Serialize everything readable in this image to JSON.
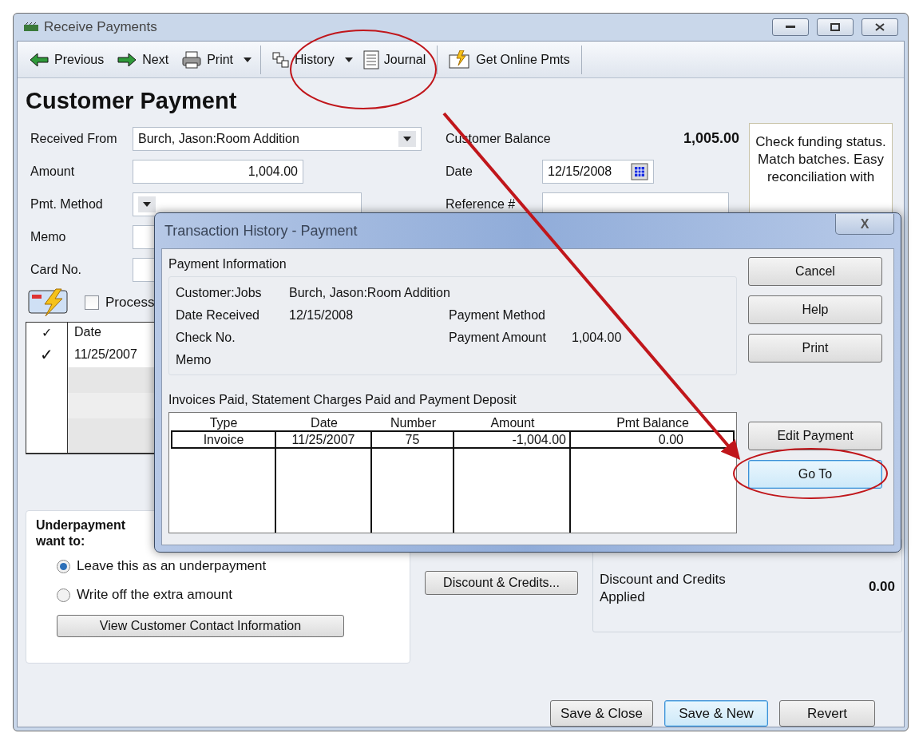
{
  "window": {
    "title": "Receive Payments"
  },
  "toolbar": [
    {
      "label": "Previous"
    },
    {
      "label": "Next"
    },
    {
      "label": "Print",
      "dropdown": true
    },
    {
      "label": "History",
      "dropdown": true
    },
    {
      "label": "Journal"
    },
    {
      "label": "Get Online Pmts"
    }
  ],
  "form": {
    "heading": "Customer Payment",
    "fields": [
      {
        "label": "Received From",
        "value": "Burch, Jason:Room Addition",
        "kind": "combo"
      },
      {
        "label": "Amount",
        "value": "1,004.00",
        "kind": "number"
      },
      {
        "label": "Pmt. Method",
        "kind": "combo"
      },
      {
        "label": "Memo",
        "kind": "text"
      },
      {
        "label": "Card No.",
        "kind": "text"
      }
    ],
    "process": {
      "label": "Process",
      "checked": false
    },
    "customer_balance": {
      "label": "Customer Balance",
      "value": "1,005.00"
    },
    "date": {
      "label": "Date",
      "value": "12/15/2008"
    },
    "reference": {
      "label": "Reference #"
    },
    "promo": "Check funding status. Match batches. Easy reconciliation with",
    "invoices": {
      "columns": [
        "✓",
        "Date"
      ],
      "rows": [
        {
          "checked": true,
          "date": "11/25/2007"
        }
      ]
    }
  },
  "underpayment": {
    "title": [
      "Underpayment",
      "want to:"
    ],
    "options": [
      {
        "label": "Leave this as an underpayment",
        "selected": true
      },
      {
        "label": "Write off the extra amount",
        "selected": false
      }
    ],
    "button": "View Customer Contact Information"
  },
  "discount_button": "Discount & Credits...",
  "summary": {
    "label": "Discount and Credits Applied",
    "value": "0.00"
  },
  "actions": [
    {
      "label": "Save & Close",
      "default": false
    },
    {
      "label": "Save & New",
      "default": true
    },
    {
      "label": "Revert",
      "default": false
    }
  ],
  "dialog": {
    "title": "Transaction History - Payment",
    "close": "X",
    "info_title": "Payment Information",
    "info": [
      {
        "label": "Customer:Jobs",
        "value": "Burch, Jason:Room Addition"
      },
      {
        "label": "Date Received",
        "value": "12/15/2008",
        "right_label": "Payment Method"
      },
      {
        "label": "Check No.",
        "right_label": "Payment Amount",
        "right_value": "1,004.00"
      },
      {
        "label": "Memo"
      }
    ],
    "table_title": "Invoices Paid, Statement Charges Paid and Payment Deposit",
    "columns": [
      "Type",
      "Date",
      "Number",
      "Amount",
      "Pmt Balance"
    ],
    "rows": [
      [
        "Invoice",
        "11/25/2007",
        "75",
        "-1,004.00",
        "0.00"
      ]
    ],
    "buttons_top": [
      {
        "label": "Cancel",
        "focused": false
      },
      {
        "label": "Help",
        "focused": false
      },
      {
        "label": "Print",
        "focused": false
      }
    ],
    "buttons_bottom": [
      {
        "label": "Edit Payment",
        "focused": false
      },
      {
        "label": "Go To",
        "focused": true
      }
    ]
  }
}
